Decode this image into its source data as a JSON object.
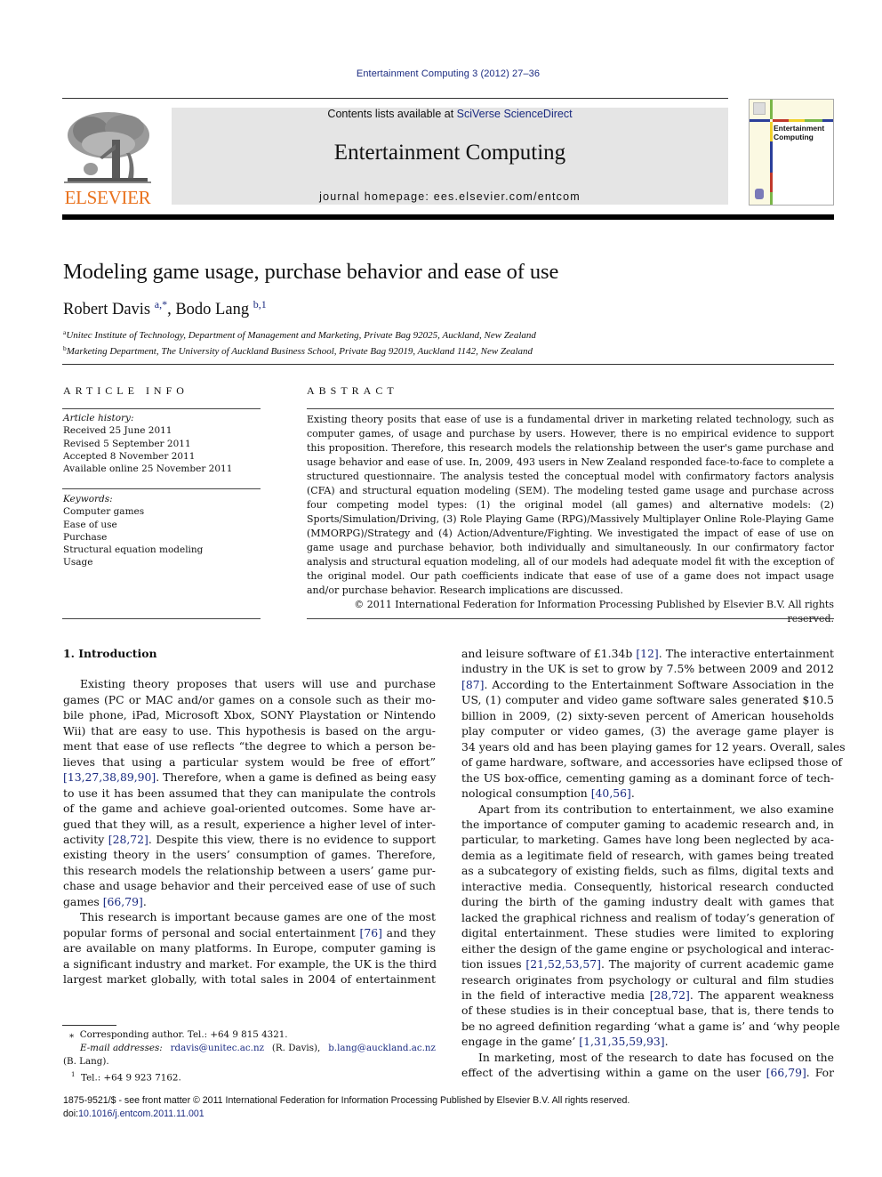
{
  "header": {
    "journal_reference": "Entertainment Computing 3 (2012) 27–36",
    "contents_prefix": "Contents lists available at ",
    "contents_link": "SciVerse ScienceDirect",
    "journal_title": "Entertainment Computing",
    "homepage": "journal homepage: ees.elsevier.com/entcom",
    "publisher_wordmark": "ELSEVIER",
    "cover_title_line1": "Entertainment",
    "cover_title_line2": "Computing",
    "colors": {
      "link": "#1a2a80",
      "elsevier_orange": "#e9711c",
      "masthead_bg": "#e5e5e5",
      "cover_green": "#7ab648",
      "cover_yellow": "#f0d02a",
      "cover_blue": "#2b3f9a",
      "cover_red": "#c0392b"
    }
  },
  "article": {
    "title": "Modeling game usage, purchase behavior and ease of use",
    "authors": [
      {
        "name": "Robert Davis",
        "marks": "a,*"
      },
      {
        "name": "Bodo Lang",
        "marks": "b,1"
      }
    ],
    "author_separator": ", ",
    "affiliations": [
      {
        "mark": "a",
        "text": "Unitec Institute of Technology, Department of Management and Marketing, Private Bag 92025, Auckland, New Zealand"
      },
      {
        "mark": "b",
        "text": "Marketing Department, The University of Auckland Business School, Private Bag 92019, Auckland 1142, New Zealand"
      }
    ]
  },
  "article_info": {
    "heading": "ARTICLE INFO",
    "history_label": "Article history:",
    "history": [
      "Received 25 June 2011",
      "Revised 5 September 2011",
      "Accepted 8 November 2011",
      "Available online 25 November 2011"
    ],
    "keywords_label": "Keywords:",
    "keywords": [
      "Computer games",
      "Ease of use",
      "Purchase",
      "Structural equation modeling",
      "Usage"
    ]
  },
  "abstract": {
    "heading": "ABSTRACT",
    "text": "Existing theory posits that ease of use is a fundamental driver in marketing related technology, such as computer games, of usage and purchase by users. However, there is no empirical evidence to support this proposition. Therefore, this research models the relationship between the user's game purchase and usage behavior and ease of use. In, 2009, 493 users in New Zealand responded face-to-face to complete a structured questionnaire. The analysis tested the conceptual model with confirmatory factors analysis (CFA) and structural equation modeling (SEM). The modeling tested game usage and purchase across four competing model types: (1) the original model (all games) and alternative models: (2) Sports/Simulation/Driving, (3) Role Playing Game (RPG)/Massively Multiplayer Online Role-Playing Game (MMORPG)/Strategy and (4) Action/Adventure/Fighting. We investigated the impact of ease of use on game usage and purchase behavior, both individually and simultaneously. In our confirmatory factor analysis and structural equation modeling, all of our models had adequate model fit with the exception of the original model. Our path coefficients indicate that ease of use of a game does not impact usage and/or purchase behavior. Research implications are discussed.",
    "copyright": "© 2011 International Federation for Information Processing Published by Elsevier B.V. All rights reserved."
  },
  "body": {
    "section_heading": "1. Introduction",
    "left_column": [
      {
        "t": "Existing theory proposes that users will use and purchase",
        "indent": true
      },
      {
        "t": "games (PC or MAC and/or games on a console such as their mo-"
      },
      {
        "t": "bile phone, iPad, Microsoft Xbox, SONY Playstation or Nintendo"
      },
      {
        "t": "Wii) that are easy to use. This hypothesis is based on the argu-"
      },
      {
        "t": "ment that ease of use reflects “the degree to which a person be-"
      },
      {
        "t": "lieves that using a particular system would be free of effort”"
      },
      {
        "cite": "[13,27,38,89,90]",
        "t": ". Therefore, when a game is defined as being easy"
      },
      {
        "t": "to use it has been assumed that they can manipulate the controls"
      },
      {
        "t": "of the game and achieve goal-oriented outcomes. Some have ar-"
      },
      {
        "t": "gued that they will, as a result, experience a higher level of inter-"
      },
      {
        "pre": "activity ",
        "cite": "[28,72]",
        "t": ". Despite this view, there is no evidence to support"
      },
      {
        "t": "existing theory in the users’ consumption of games. Therefore,"
      },
      {
        "t": "this research models the relationship between a users’ game pur-"
      },
      {
        "t": "chase and usage behavior and their perceived ease of use of such"
      },
      {
        "pre": "games ",
        "cite": "[66,79]",
        "t": ".",
        "last": true
      },
      {
        "t": "This research is important because games are one of the most",
        "indent": true
      },
      {
        "pre": "popular forms of personal and social entertainment ",
        "cite": "[76]",
        "t": " and they"
      },
      {
        "t": "are available on many platforms. In Europe, computer gaming is"
      },
      {
        "t": "a significant industry and market. For example, the UK is the third"
      },
      {
        "t": "largest market globally, with total sales in 2004 of entertainment"
      }
    ],
    "right_column": [
      {
        "pre": "and leisure software of £1.34b ",
        "cite": "[12]",
        "t": ". The interactive entertainment"
      },
      {
        "t": "industry in the UK is set to grow by 7.5% between 2009 and 2012"
      },
      {
        "cite": "[87]",
        "t": ". According to the Entertainment Software Association in the"
      },
      {
        "t": "US, (1) computer and video game software sales generated $10.5"
      },
      {
        "t": "billion in 2009, (2) sixty-seven percent of American households"
      },
      {
        "t": "play computer or video games, (3) the average game player is"
      },
      {
        "t": "34 years old and has been playing games for 12 years. Overall, sales"
      },
      {
        "t": "of game hardware, software, and accessories have eclipsed those of"
      },
      {
        "t": "the US box-office, cementing gaming as a dominant force of tech-"
      },
      {
        "pre": "nological consumption ",
        "cite": "[40,56]",
        "t": ".",
        "last": true
      },
      {
        "t": "Apart from its contribution to entertainment, we also examine",
        "indent": true
      },
      {
        "t": "the importance of computer gaming to academic research and, in"
      },
      {
        "t": "particular, to marketing. Games have long been neglected by aca-"
      },
      {
        "t": "demia as a legitimate field of research, with games being treated"
      },
      {
        "t": "as a subcategory of existing fields, such as films, digital texts and"
      },
      {
        "t": "interactive media. Consequently, historical research conducted"
      },
      {
        "t": "during the birth of the gaming industry dealt with games that"
      },
      {
        "t": "lacked the graphical richness and realism of today’s generation of"
      },
      {
        "t": "digital entertainment. These studies were limited to exploring"
      },
      {
        "t": "either the design of the game engine or psychological and interac-"
      },
      {
        "pre": "tion issues ",
        "cite": "[21,52,53,57]",
        "t": ". The majority of current academic game"
      },
      {
        "t": "research originates from psychology or cultural and film studies"
      },
      {
        "pre": "in the field of interactive media ",
        "cite": "[28,72]",
        "t": ". The apparent weakness"
      },
      {
        "t": "of these studies is in their conceptual base, that is, there tends to"
      },
      {
        "t": "be no agreed definition regarding ‘what a game is’ and ‘why people"
      },
      {
        "pre": "engage in the game’ ",
        "cite": "[1,31,35,59,93]",
        "t": ".",
        "last": true
      },
      {
        "t": "In marketing, most of the research to date has focused on the",
        "indent": true
      },
      {
        "pre": "effect of the advertising within a game on the user ",
        "cite": "[66,79]",
        "t": ". For"
      }
    ]
  },
  "footnotes": {
    "corresponding_mark": "⁎",
    "corresponding": "Corresponding author. Tel.: +64 9 815 4321.",
    "email_label": "E-mail addresses:",
    "emails": [
      {
        "address": "rdavis@unitec.ac.nz",
        "who": "(R. Davis),"
      },
      {
        "address": "b.lang@auckland.ac.nz",
        "who": "(B. Lang)."
      }
    ],
    "note1_mark": "1",
    "note1": "Tel.: +64 9 923 7162."
  },
  "bottom": {
    "issn_line": "1875-9521/$ - see front matter © 2011 International Federation for Information Processing Published by Elsevier B.V. All rights reserved.",
    "doi_prefix": "doi:",
    "doi": "10.1016/j.entcom.2011.11.001"
  }
}
